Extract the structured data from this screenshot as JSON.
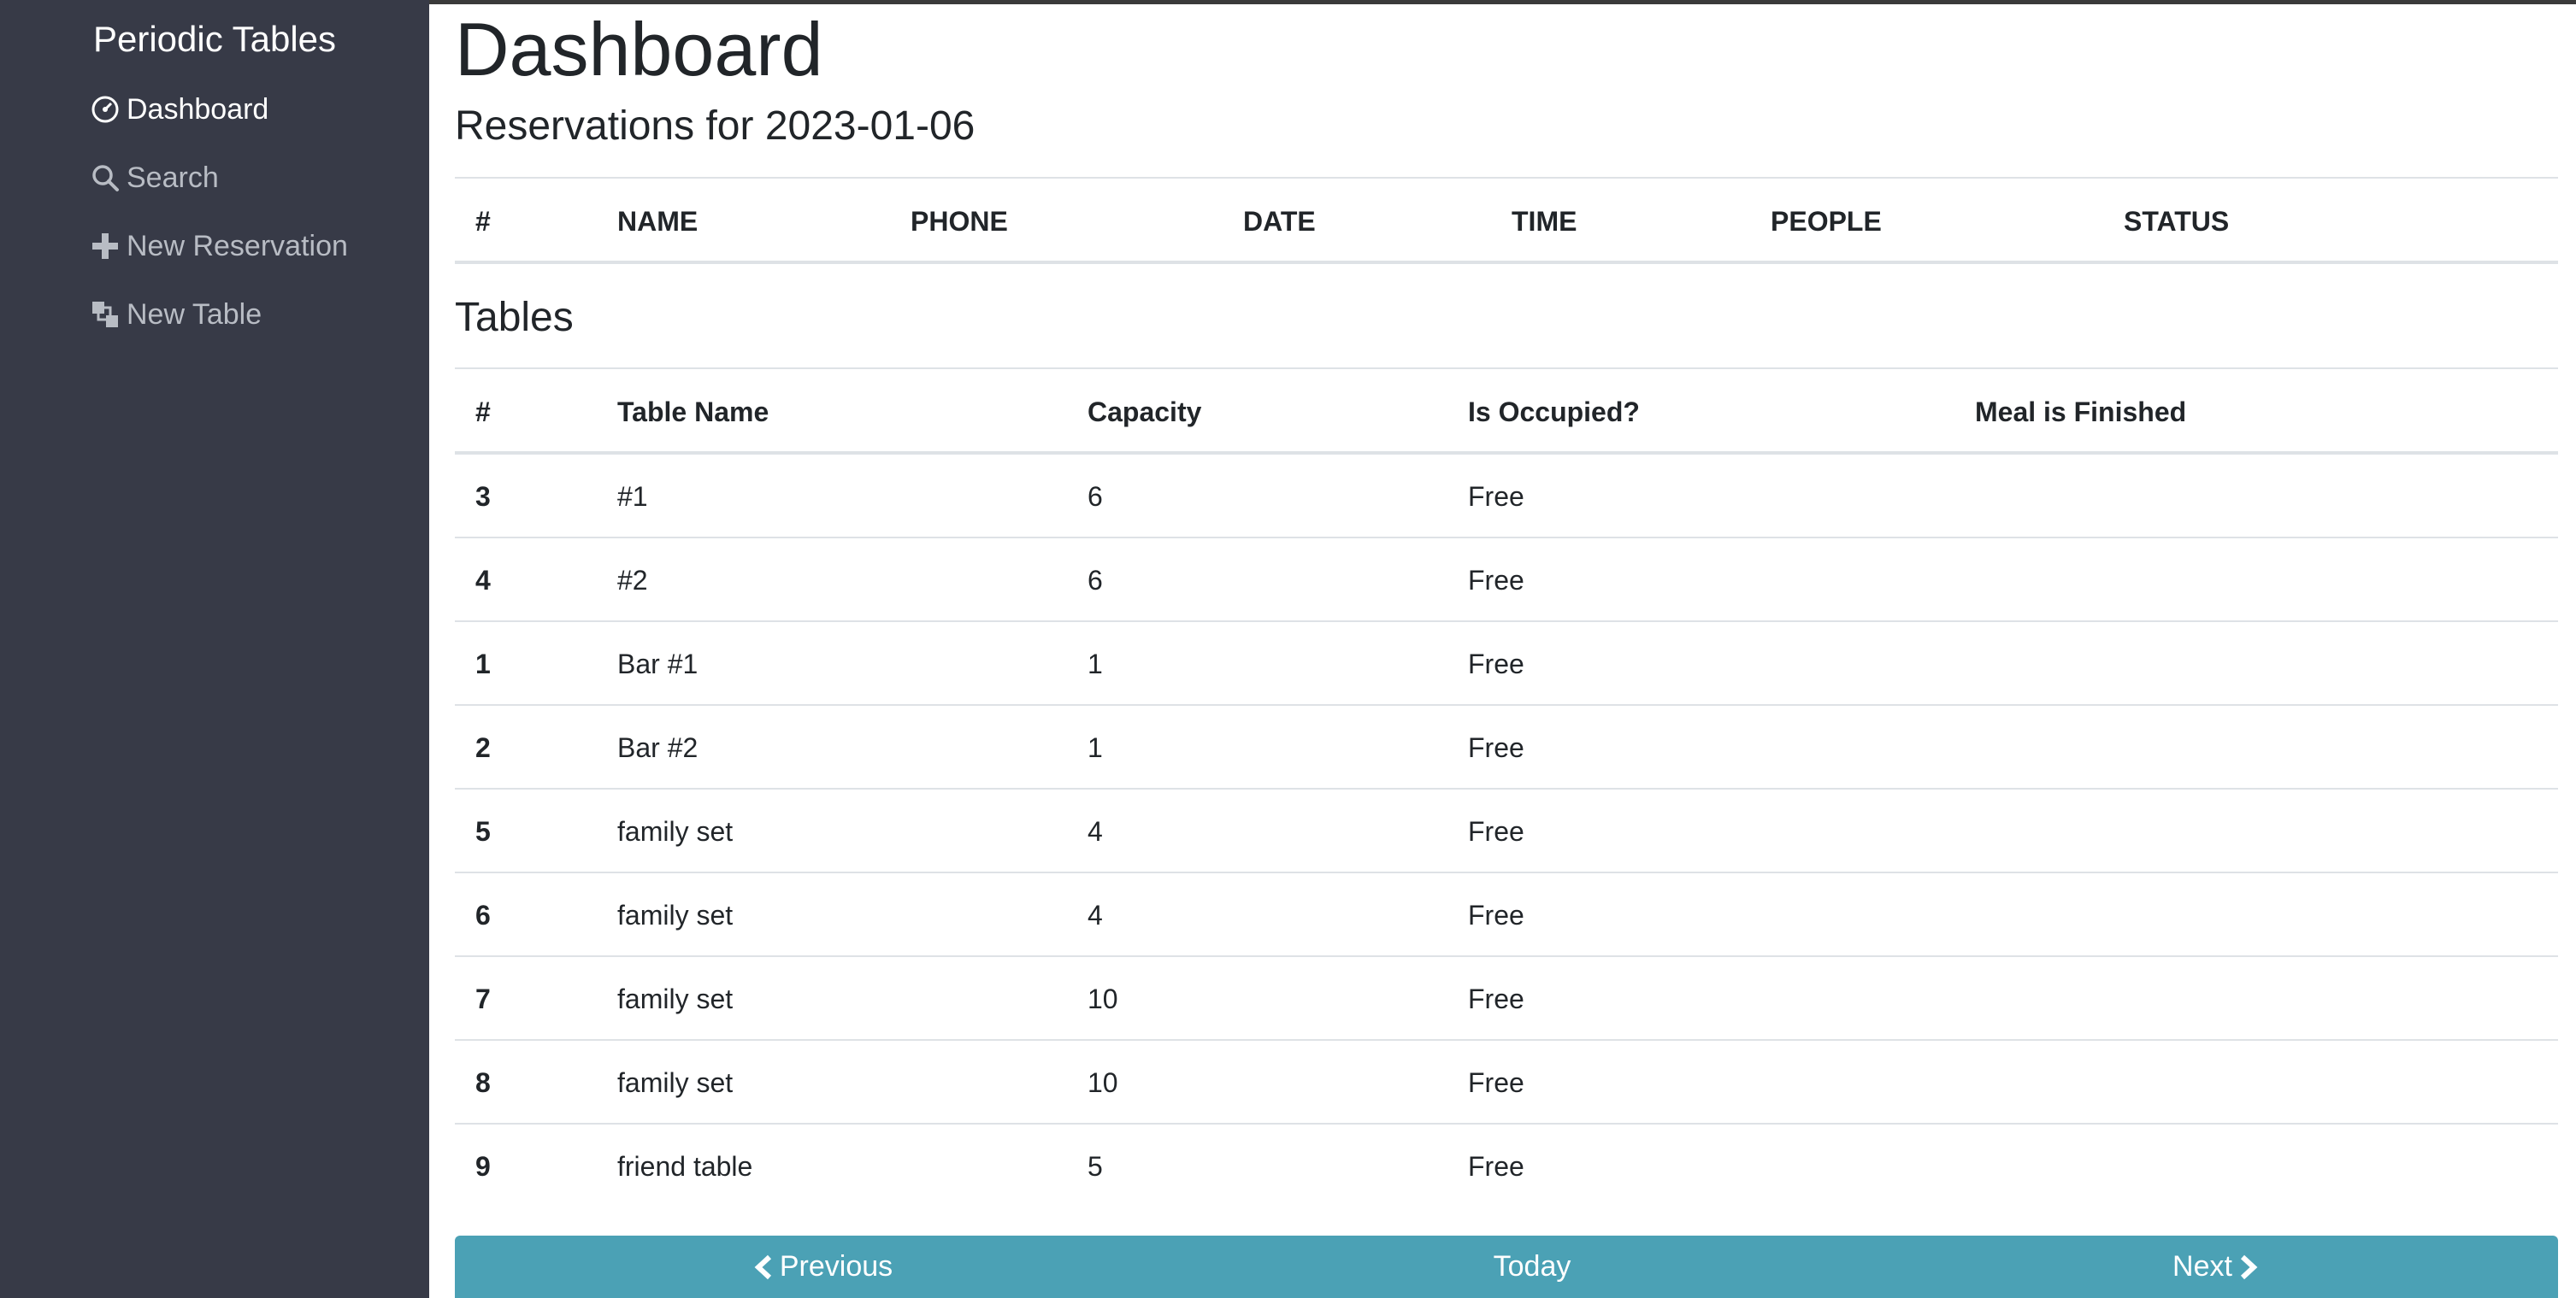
{
  "sidebar": {
    "brand": "Periodic Tables",
    "items": [
      {
        "label": "Dashboard",
        "icon": "dashboard-icon"
      },
      {
        "label": "Search",
        "icon": "search-icon"
      },
      {
        "label": "New Reservation",
        "icon": "plus-icon"
      },
      {
        "label": "New Table",
        "icon": "new-table-icon"
      }
    ]
  },
  "main": {
    "title": "Dashboard",
    "reservations_heading": "Reservations for 2023-01-06",
    "reservation_columns": [
      "#",
      "NAME",
      "PHONE",
      "DATE",
      "TIME",
      "PEOPLE",
      "STATUS"
    ],
    "tables_heading": "Tables",
    "table_columns": [
      "#",
      "Table Name",
      "Capacity",
      "Is Occupied?",
      "Meal is Finished"
    ],
    "tables": [
      {
        "id": "3",
        "name": "#1",
        "capacity": "6",
        "status": "Free"
      },
      {
        "id": "4",
        "name": "#2",
        "capacity": "6",
        "status": "Free"
      },
      {
        "id": "1",
        "name": "Bar #1",
        "capacity": "1",
        "status": "Free"
      },
      {
        "id": "2",
        "name": "Bar #2",
        "capacity": "1",
        "status": "Free"
      },
      {
        "id": "5",
        "name": "family set",
        "capacity": "4",
        "status": "Free"
      },
      {
        "id": "6",
        "name": "family set",
        "capacity": "4",
        "status": "Free"
      },
      {
        "id": "7",
        "name": "family set",
        "capacity": "10",
        "status": "Free"
      },
      {
        "id": "8",
        "name": "family set",
        "capacity": "10",
        "status": "Free"
      },
      {
        "id": "9",
        "name": "friend table",
        "capacity": "5",
        "status": "Free"
      }
    ]
  },
  "nav_buttons": {
    "previous": "Previous",
    "today": "Today",
    "next": "Next"
  },
  "colors": {
    "sidebar": "#373a47",
    "button_bar": "#4ba1b5",
    "rule": "#dee2e6"
  }
}
